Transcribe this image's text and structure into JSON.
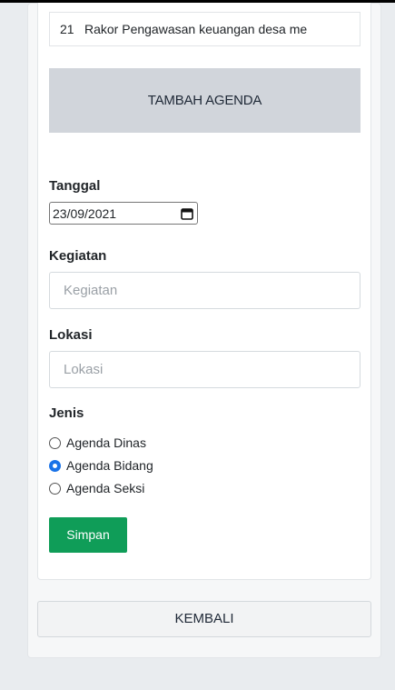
{
  "agenda_list": {
    "items": [
      {
        "number": "21",
        "title": "Rakor Pengawasan keuangan desa me"
      }
    ]
  },
  "tambah_button": {
    "label": "TAMBAH AGENDA"
  },
  "form": {
    "tanggal": {
      "label": "Tanggal",
      "value": "23/09/2021"
    },
    "kegiatan": {
      "label": "Kegiatan",
      "placeholder": "Kegiatan",
      "value": ""
    },
    "lokasi": {
      "label": "Lokasi",
      "placeholder": "Lokasi",
      "value": ""
    },
    "jenis": {
      "label": "Jenis",
      "options": [
        {
          "label": "Agenda Dinas",
          "checked": false
        },
        {
          "label": "Agenda Bidang",
          "checked": true
        },
        {
          "label": "Agenda Seksi",
          "checked": false
        }
      ]
    },
    "submit_label": "Simpan"
  },
  "kembali_button": {
    "label": "KEMBALI"
  },
  "colors": {
    "primary_green": "#0f9d58",
    "radio_accent": "#1a73e8",
    "tambah_bg": "#d1d5db"
  },
  "icons": {
    "date_picker": "calendar-icon"
  }
}
